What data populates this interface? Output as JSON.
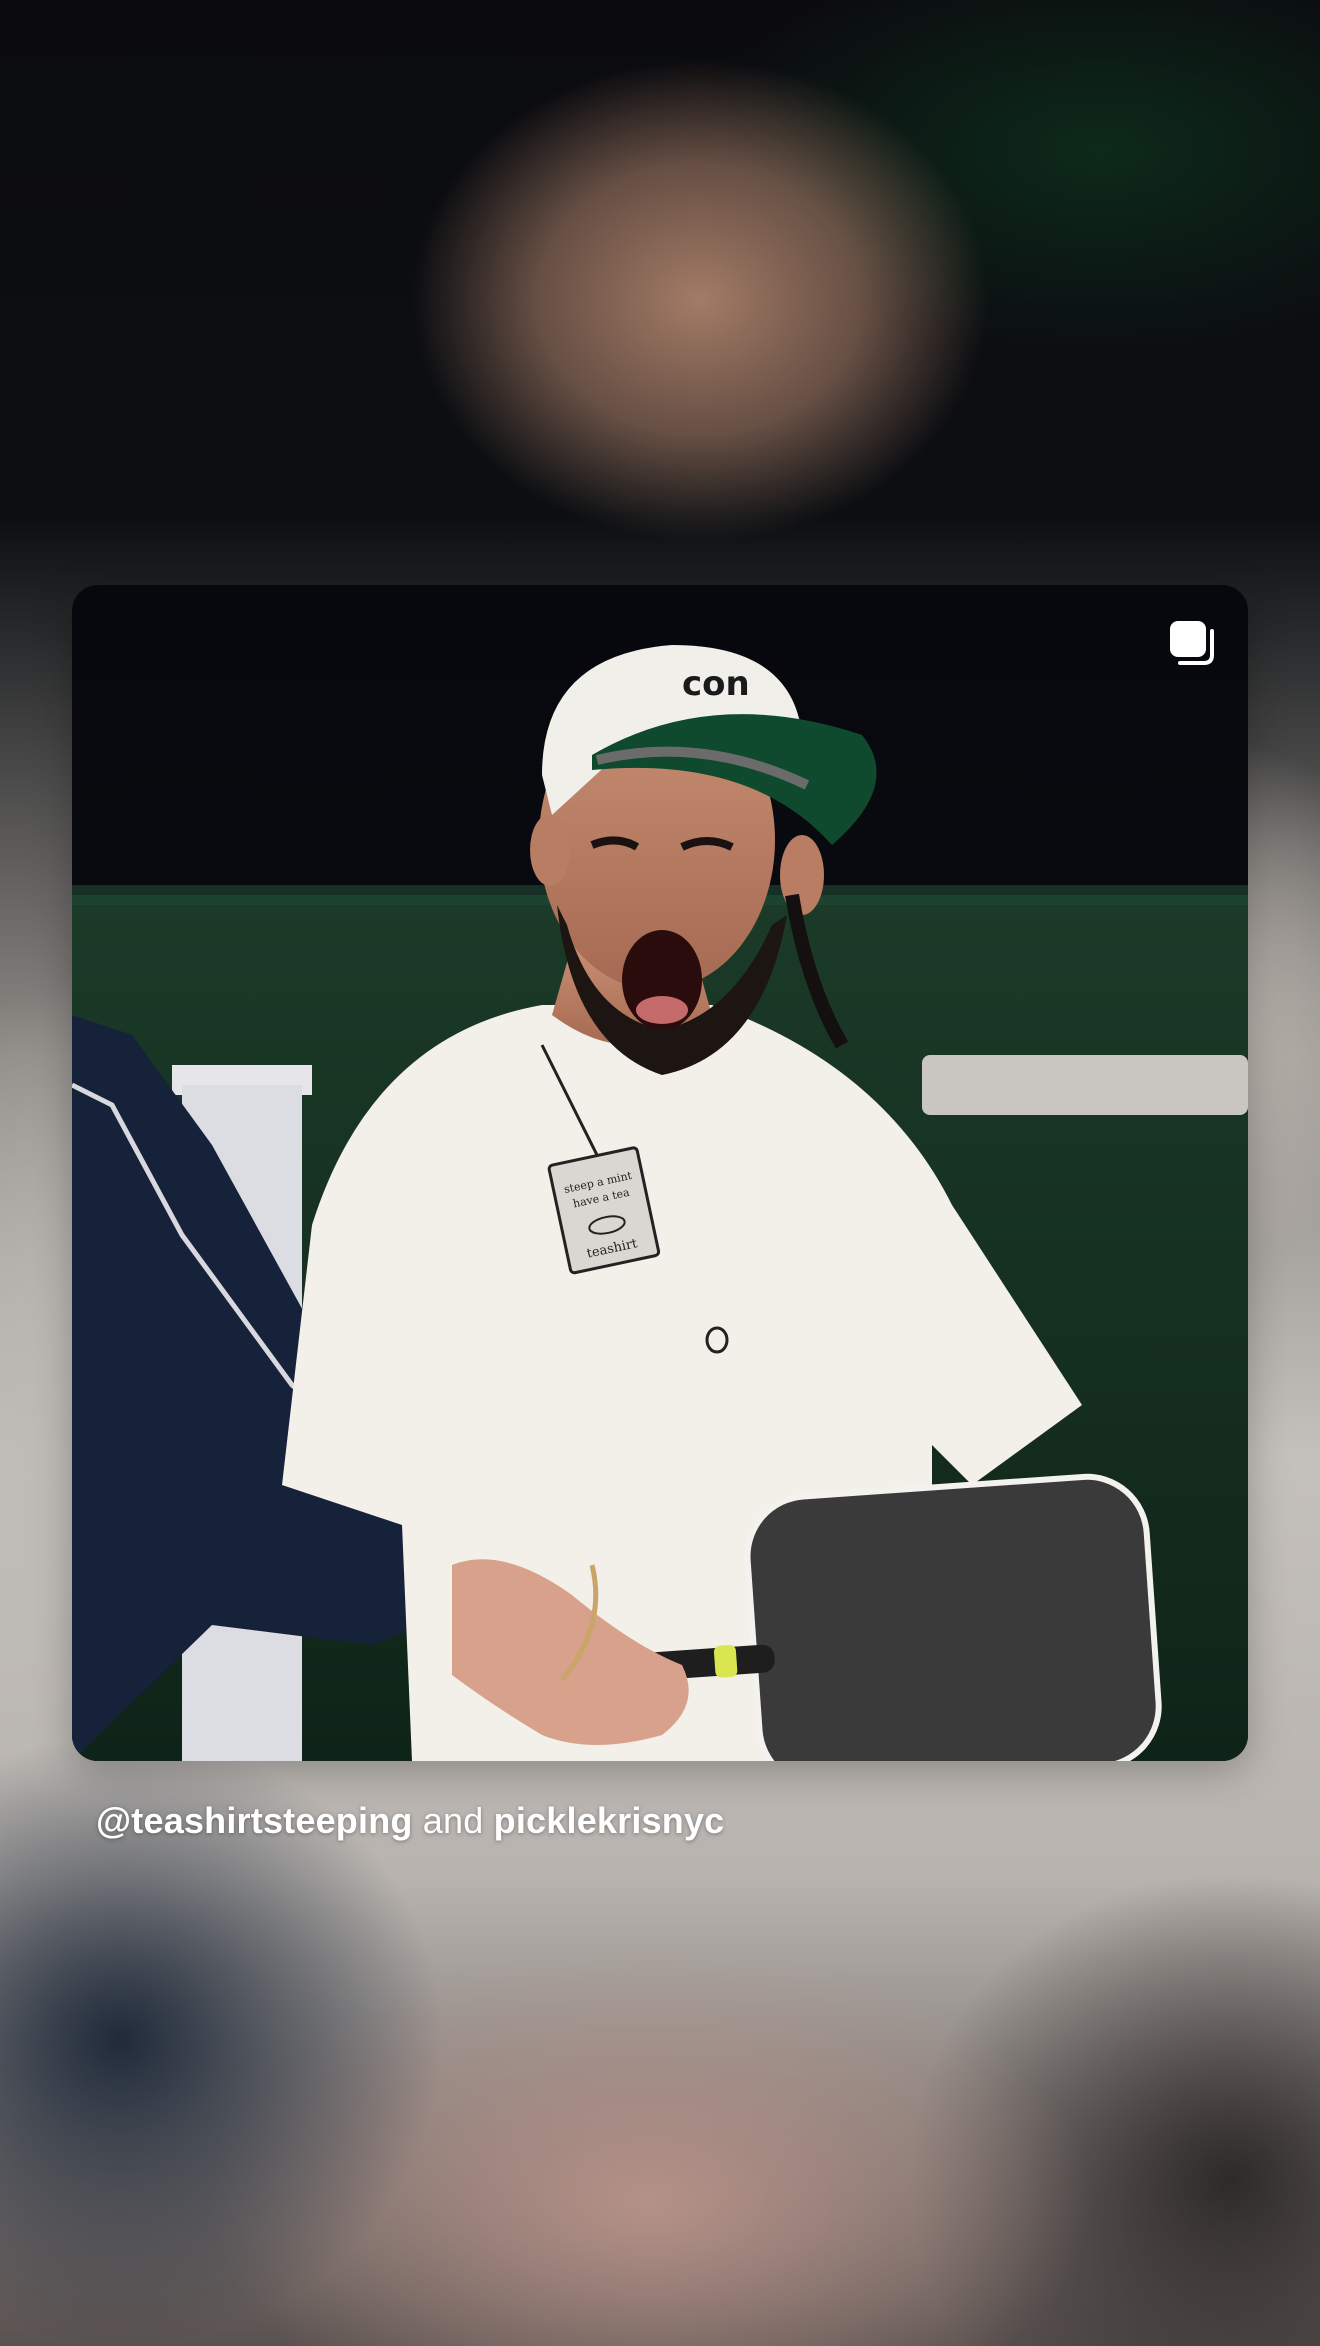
{
  "caption": {
    "mention_1": "@teashirtsteeping",
    "connector": "and",
    "mention_2": "picklekrisnyc"
  },
  "photo": {
    "multi_item_indicator_icon": "carousel-stack-icon",
    "tag_text_line_1": "steep a mint",
    "tag_text_line_2": "have a tea",
    "tag_brand": "teashirt",
    "cap_text": "con"
  },
  "colors": {
    "caption_text": "#ffffff",
    "cap_brim": "#0f4a2e",
    "shirt": "#f3efe9",
    "paddle_face": "#3a3a3a"
  }
}
